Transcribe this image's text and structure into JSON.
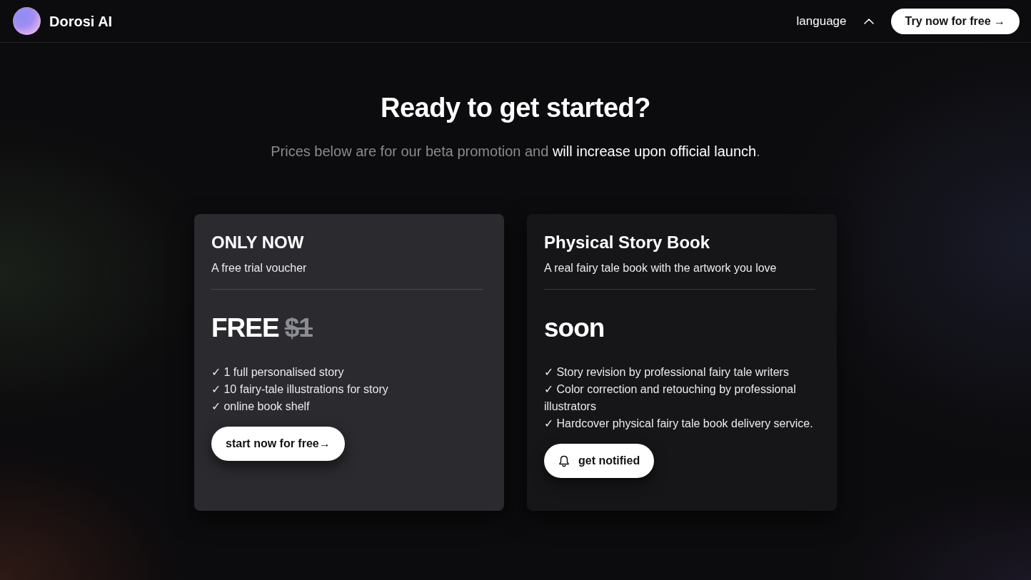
{
  "navbar": {
    "brand": "Dorosi AI",
    "language": "language",
    "cta": "Try now for free →"
  },
  "hero": {
    "title": "Ready to get started?",
    "subtitle": "Prices below are for our beta promotion and **will increase upon official launch**."
  },
  "plans": [
    {
      "title": "ONLY NOW",
      "description": "A free trial voucher",
      "highlighted": true,
      "price": "FREE",
      "old_price": "$1",
      "features": [
        "✓ 1 full personalised story",
        "✓ 10 fairy-tale illustrations for story",
        "✓ online book shelf"
      ],
      "button": {
        "label": "start now for free→",
        "kind": "start"
      }
    },
    {
      "title": "Physical Story Book",
      "description": "A real fairy tale book with the artwork you love",
      "highlighted": false,
      "price": "soon",
      "features": [
        "✓ Story revision by professional fairy tale writers",
        "✓ Color correction and retouching by professional illustrators",
        "✓ Hardcover physical fairy tale book delivery service."
      ],
      "button": {
        "label": "get notified",
        "kind": "notify"
      }
    }
  ]
}
